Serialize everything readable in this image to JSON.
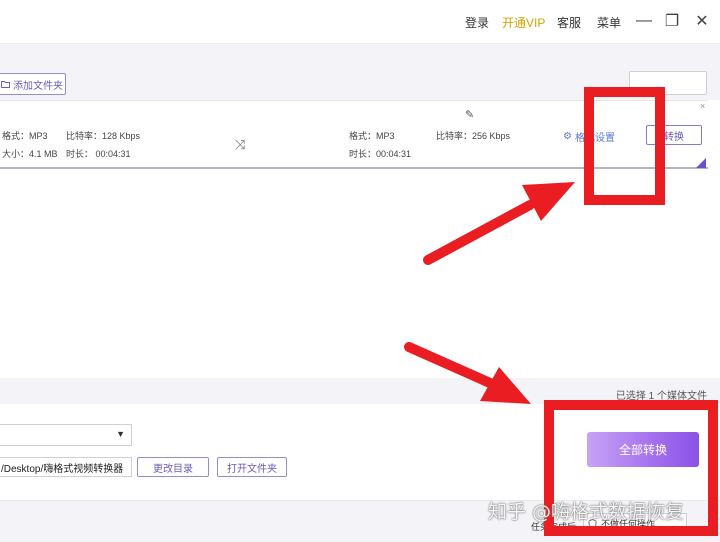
{
  "titlebar": {
    "login": "登录",
    "vip": "开通VIP",
    "service": "客服",
    "menu": "菜单",
    "minimize": "—",
    "restore": "❐",
    "close": "✕"
  },
  "toolbar": {
    "add_folder": "添加文件夹",
    "add_folder_icon": "folder-plus-icon"
  },
  "file_row": {
    "source": {
      "format": "格式：MP3",
      "bitrate": "比特率：128 Kbps",
      "size": "大小：4.1 MB",
      "duration": "时长：  00:04:31"
    },
    "target": {
      "format": "格式：MP3",
      "bitrate": "比特率：256 Kbps",
      "duration": "时长：00:04:31"
    },
    "edit_glyph": "✎",
    "shuffle_glyph": "⤨",
    "format_settings": "格式设置",
    "gear_glyph": "⚙",
    "convert": "转换",
    "remove_glyph": "×"
  },
  "status": {
    "selected_count": "已选择 1 个媒体文件"
  },
  "bottom": {
    "output_path": "/Desktop/嗨格式视频转换器",
    "change_dir": "更改目录",
    "open_folder": "打开文件夹",
    "convert_all": "全部转换",
    "caret": "▼"
  },
  "footer": {
    "after_label": "任务完成后",
    "after_value": "不做任何操作",
    "watermark": "知乎 @嗨格式数据恢复"
  },
  "colors": {
    "accent": "#8a52e6",
    "vip": "#d4a300",
    "annotation_red": "#ea1d22"
  }
}
